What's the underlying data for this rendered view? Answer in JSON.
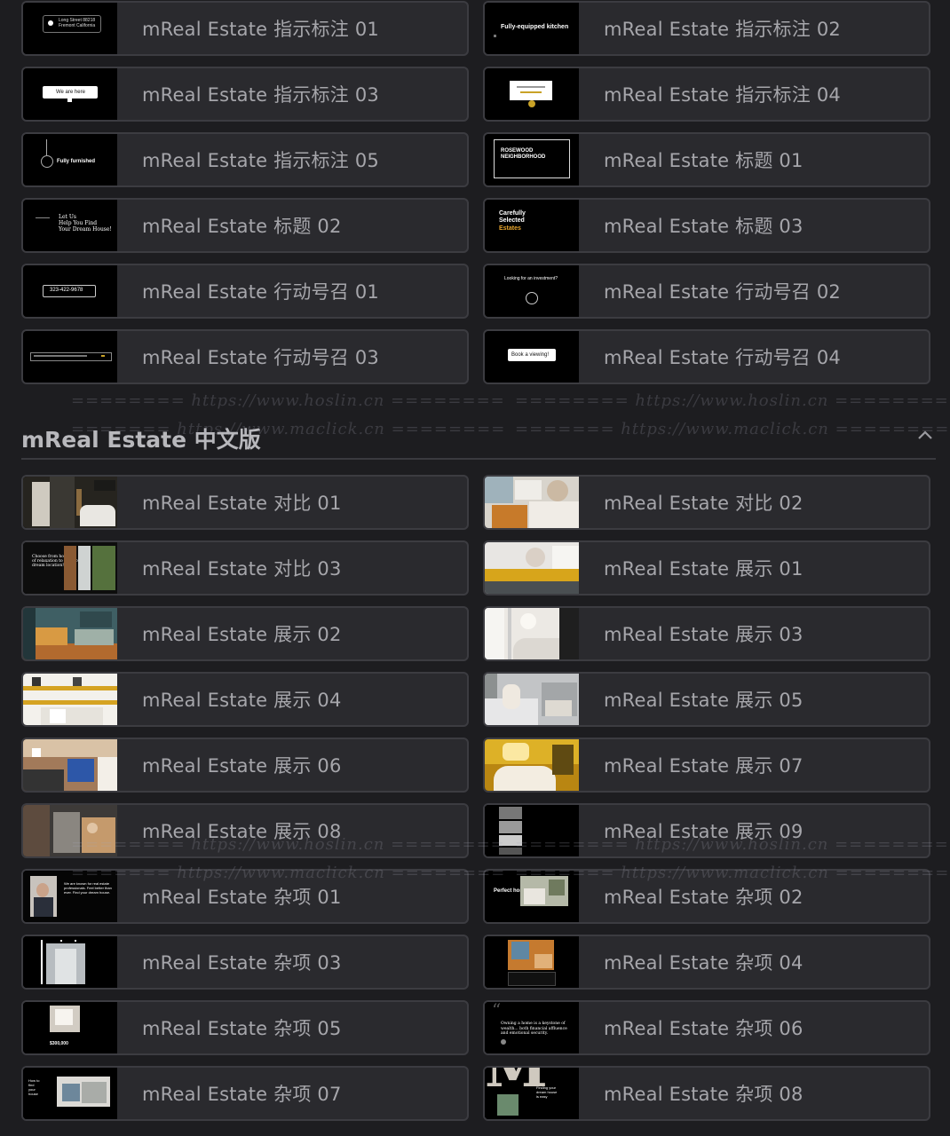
{
  "top_items": [
    {
      "label": "mReal Estate 指示标注 01",
      "thumb": "callout-address"
    },
    {
      "label": "mReal Estate 指示标注 02",
      "thumb": "callout-kitchen"
    },
    {
      "label": "mReal Estate 指示标注 03",
      "thumb": "callout-we-are-here"
    },
    {
      "label": "mReal Estate 指示标注 04",
      "thumb": "callout-property"
    },
    {
      "label": "mReal Estate 指示标注 05",
      "thumb": "callout-furnished"
    },
    {
      "label": "mReal Estate 标题 01",
      "thumb": "title-rosewood"
    },
    {
      "label": "mReal Estate 标题 02",
      "thumb": "title-dream-house"
    },
    {
      "label": "mReal Estate 标题 03",
      "thumb": "title-selected-estates"
    },
    {
      "label": "mReal Estate 行动号召 01",
      "thumb": "cta-phone"
    },
    {
      "label": "mReal Estate 行动号召 02",
      "thumb": "cta-investment"
    },
    {
      "label": "mReal Estate 行动号召 03",
      "thumb": "cta-search"
    },
    {
      "label": "mReal Estate 行动号召 04",
      "thumb": "cta-book"
    }
  ],
  "section": {
    "title": "mReal Estate 中文版",
    "collapse_icon": "chevron-up-icon"
  },
  "bottom_items": [
    {
      "label": "mReal Estate 对比 01",
      "thumb": "bathroom"
    },
    {
      "label": "mReal Estate 对比 02",
      "thumb": "bedroom"
    },
    {
      "label": "mReal Estate 对比 03",
      "thumb": "compare-dark"
    },
    {
      "label": "mReal Estate 展示 01",
      "thumb": "yellow-strip"
    },
    {
      "label": "mReal Estate 展示 02",
      "thumb": "living-room"
    },
    {
      "label": "mReal Estate 展示 03",
      "thumb": "bath-white"
    },
    {
      "label": "mReal Estate 展示 04",
      "thumb": "shelves"
    },
    {
      "label": "mReal Estate 展示 05",
      "thumb": "woman-bed"
    },
    {
      "label": "mReal Estate 展示 06",
      "thumb": "stairs"
    },
    {
      "label": "mReal Estate 展示 07",
      "thumb": "golden-bath"
    },
    {
      "label": "mReal Estate 展示 08",
      "thumb": "couple"
    },
    {
      "label": "mReal Estate 展示 09",
      "thumb": "collage-dark"
    },
    {
      "label": "mReal Estate 杂项 01",
      "thumb": "agent"
    },
    {
      "label": "mReal Estate 杂项 02",
      "thumb": "perfect-home"
    },
    {
      "label": "mReal Estate 杂项 03",
      "thumb": "hallway"
    },
    {
      "label": "mReal Estate 杂项 04",
      "thumb": "interior-card"
    },
    {
      "label": "mReal Estate 杂项 05",
      "thumb": "listing-price"
    },
    {
      "label": "mReal Estate 杂项 06",
      "thumb": "quote"
    },
    {
      "label": "mReal Estate 杂项 07",
      "thumb": "split-room"
    },
    {
      "label": "mReal Estate 杂项 08",
      "thumb": "big-m"
    }
  ],
  "watermarks": [
    "======== https://www.hoslin.cn ========",
    "======= https://www.maclick.cn ========"
  ],
  "thumb_text": {
    "address": "Long Street 88218\nFremont California",
    "kitchen": "Fully-equipped kitchen",
    "we_are_here": "We are here",
    "furnished": "Fully furnished",
    "rosewood": "ROSEWOOD\nNEIGHBORHOOD",
    "dream": "Let Us\nHelp You Find\nYour Dream House!",
    "selected": "Carefully\nSelected",
    "estates": "Estates",
    "phone": "323-422-9678",
    "investment": "Looking for an investment?",
    "book": "Book a viewing!",
    "perfect": "Perfect home",
    "price": "$300,000"
  }
}
